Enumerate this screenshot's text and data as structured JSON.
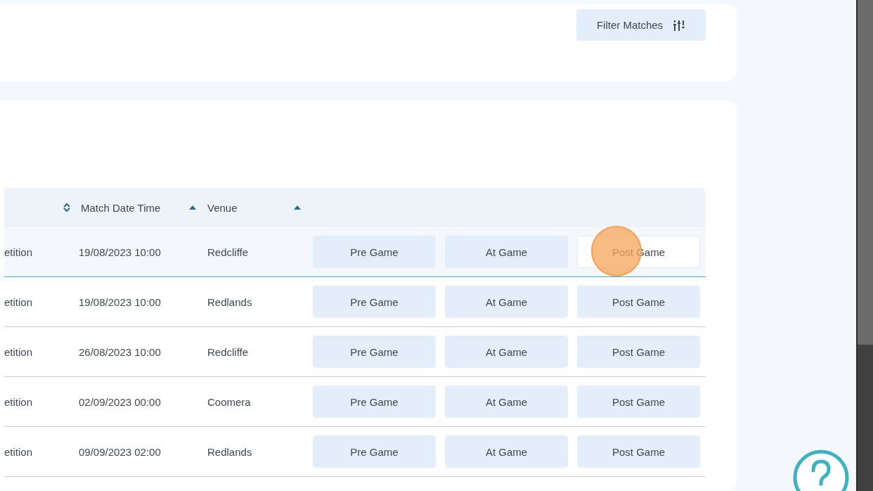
{
  "filter_button": {
    "label": "Filter Matches"
  },
  "table": {
    "columns": [
      {
        "sorted": false
      },
      {
        "label": "Match Date Time",
        "sorted": true
      },
      {
        "label": "Venue",
        "sorted": true
      }
    ],
    "rows": [
      {
        "competition": "etition",
        "date_time": "19/08/2023 10:00",
        "venue": "Redcliffe",
        "highlighted": true,
        "actions": [
          {
            "label": "Pre Game",
            "highlighted": false,
            "click_marker": false
          },
          {
            "label": "At Game",
            "highlighted": false,
            "click_marker": false
          },
          {
            "label": "Post Game",
            "highlighted": true,
            "click_marker": true
          }
        ]
      },
      {
        "competition": "etition",
        "date_time": "19/08/2023 10:00",
        "venue": "Redlands",
        "highlighted": false,
        "actions": [
          {
            "label": "Pre Game",
            "highlighted": false,
            "click_marker": false
          },
          {
            "label": "At Game",
            "highlighted": false,
            "click_marker": false
          },
          {
            "label": "Post Game",
            "highlighted": false,
            "click_marker": false
          }
        ]
      },
      {
        "competition": "etition",
        "date_time": "26/08/2023 10:00",
        "venue": "Redcliffe",
        "highlighted": false,
        "actions": [
          {
            "label": "Pre Game",
            "highlighted": false,
            "click_marker": false
          },
          {
            "label": "At Game",
            "highlighted": false,
            "click_marker": false
          },
          {
            "label": "Post Game",
            "highlighted": false,
            "click_marker": false
          }
        ]
      },
      {
        "competition": "etition",
        "date_time": "02/09/2023 00:00",
        "venue": "Coomera",
        "highlighted": false,
        "actions": [
          {
            "label": "Pre Game",
            "highlighted": false,
            "click_marker": false
          },
          {
            "label": "At Game",
            "highlighted": false,
            "click_marker": false
          },
          {
            "label": "Post Game",
            "highlighted": false,
            "click_marker": false
          }
        ]
      },
      {
        "competition": "etition",
        "date_time": "09/09/2023 02:00",
        "venue": "Redlands",
        "highlighted": false,
        "actions": [
          {
            "label": "Pre Game",
            "highlighted": false,
            "click_marker": false
          },
          {
            "label": "At Game",
            "highlighted": false,
            "click_marker": false
          },
          {
            "label": "Post Game",
            "highlighted": false,
            "click_marker": false
          }
        ]
      }
    ]
  }
}
